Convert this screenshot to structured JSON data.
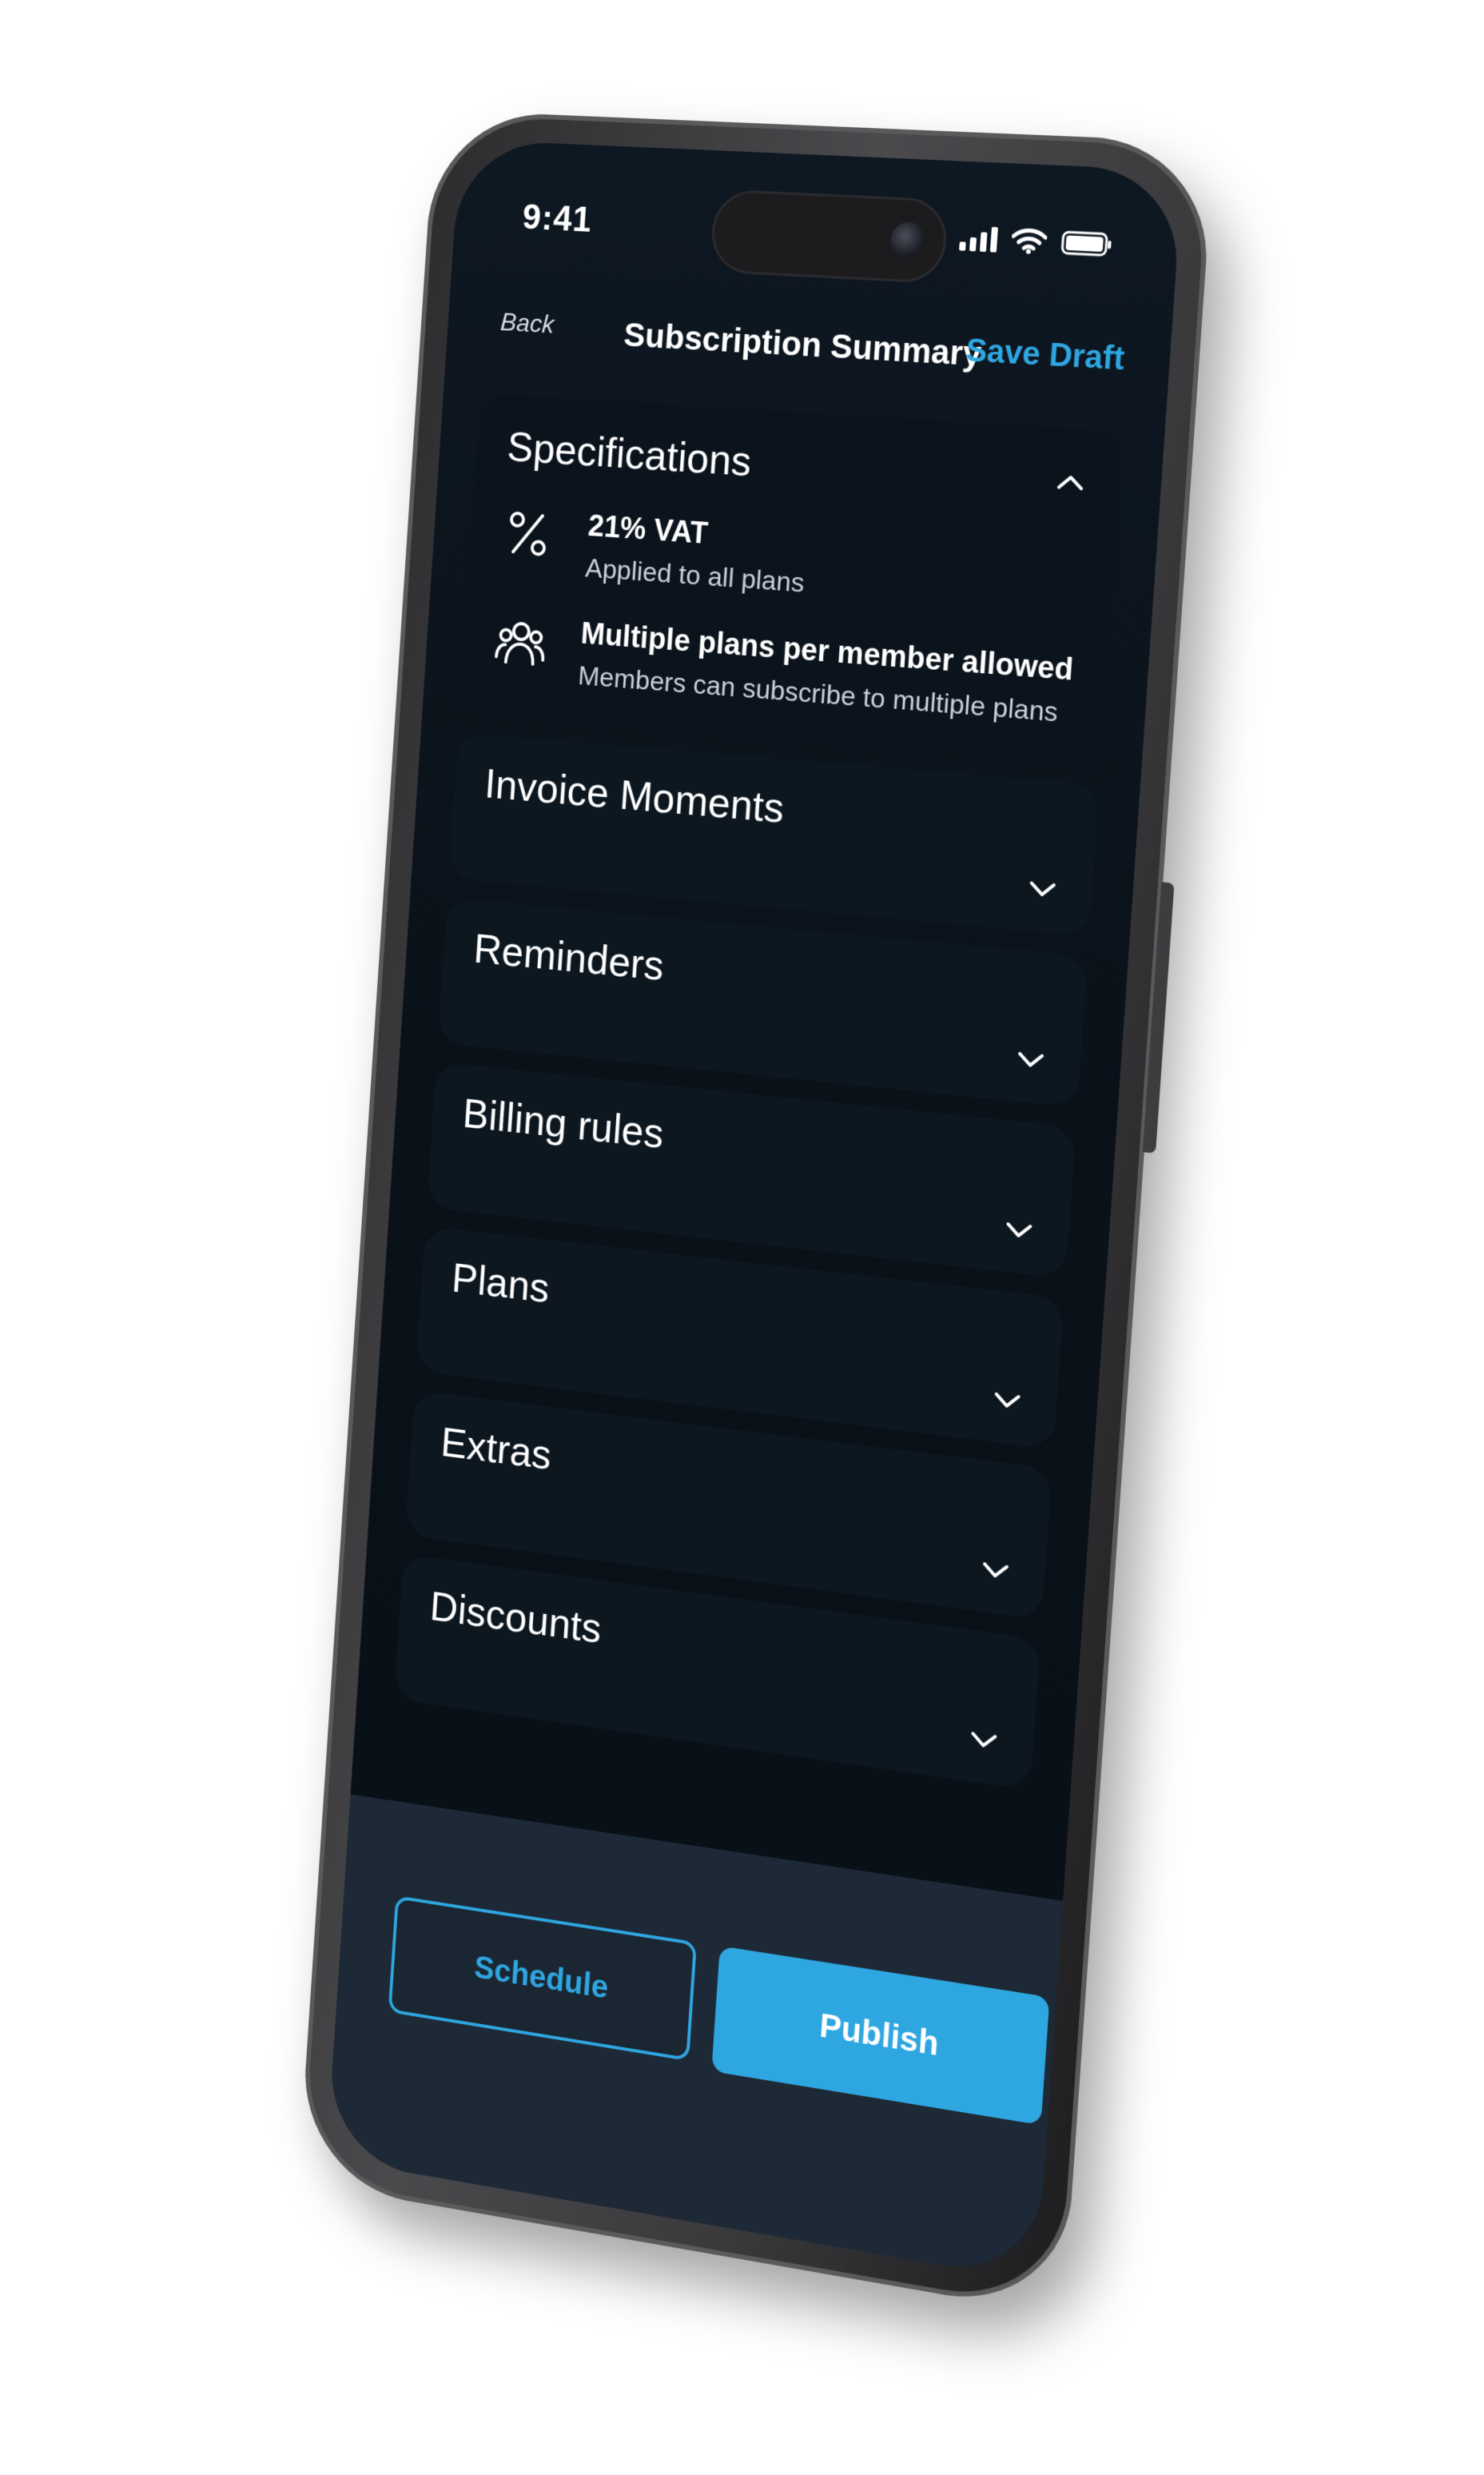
{
  "status_bar": {
    "time": "9:41",
    "icons": [
      "signal-icon",
      "wifi-icon",
      "battery-icon"
    ]
  },
  "nav": {
    "back_label": "Back",
    "title": "Subscription Summary",
    "save_draft_label": "Save Draft"
  },
  "sections": {
    "specifications": {
      "title": "Specifications",
      "expanded": true,
      "items": [
        {
          "icon": "percent-icon",
          "title": "21% VAT",
          "subtitle": "Applied to all plans"
        },
        {
          "icon": "users-icon",
          "title": "Multiple plans per member allowed",
          "subtitle": "Members can subscribe to multiple plans"
        }
      ]
    },
    "collapsed": [
      {
        "title": "Invoice Moments"
      },
      {
        "title": "Reminders"
      },
      {
        "title": "Billing rules"
      },
      {
        "title": "Plans"
      },
      {
        "title": "Extras"
      },
      {
        "title": "Discounts"
      }
    ]
  },
  "actions": {
    "schedule_label": "Schedule",
    "publish_label": "Publish"
  },
  "colors": {
    "accent": "#2ea6e0",
    "screen_background": "#0a1119",
    "bottom_bar": "#1d2936"
  }
}
